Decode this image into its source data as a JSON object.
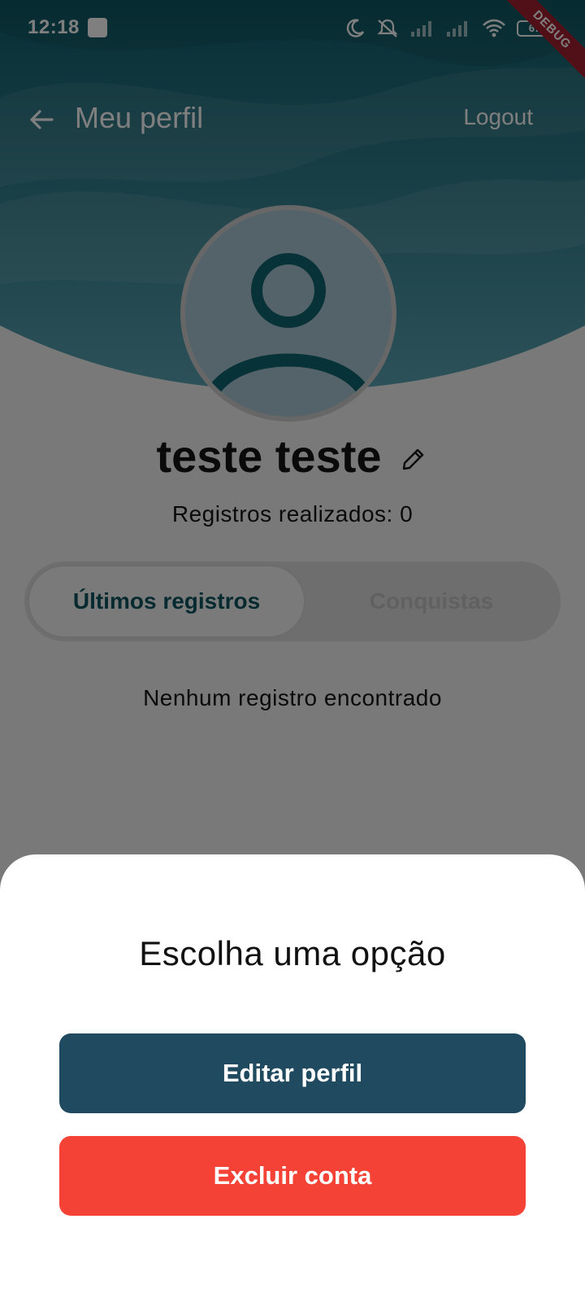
{
  "status_bar": {
    "time": "12:18",
    "battery_level": "67",
    "icons": [
      "notification-icon",
      "moon-icon",
      "vibrate-off-icon",
      "signal-icon",
      "signal-icon",
      "wifi-icon",
      "battery-icon"
    ]
  },
  "debug_banner": "DEBUG",
  "app_bar": {
    "title": "Meu perfil",
    "logout_label": "Logout",
    "back_icon": "arrow-left-icon"
  },
  "profile": {
    "name": "teste teste",
    "edit_icon": "pencil-icon",
    "avatar_icon": "person-icon",
    "records_text": "Registros realizados: 0"
  },
  "tabs": [
    {
      "label": "Últimos registros",
      "selected": true
    },
    {
      "label": "Conquistas",
      "selected": false
    }
  ],
  "empty_message": "Nenhum registro encontrado",
  "bottom_sheet": {
    "title": "Escolha uma opção",
    "edit_label": "Editar perfil",
    "delete_label": "Excluir conta"
  },
  "colors": {
    "header_teal": "#0e6a78",
    "tab_active_text": "#0d5560",
    "edit_button": "#1f4a60",
    "delete_button": "#f44336"
  }
}
